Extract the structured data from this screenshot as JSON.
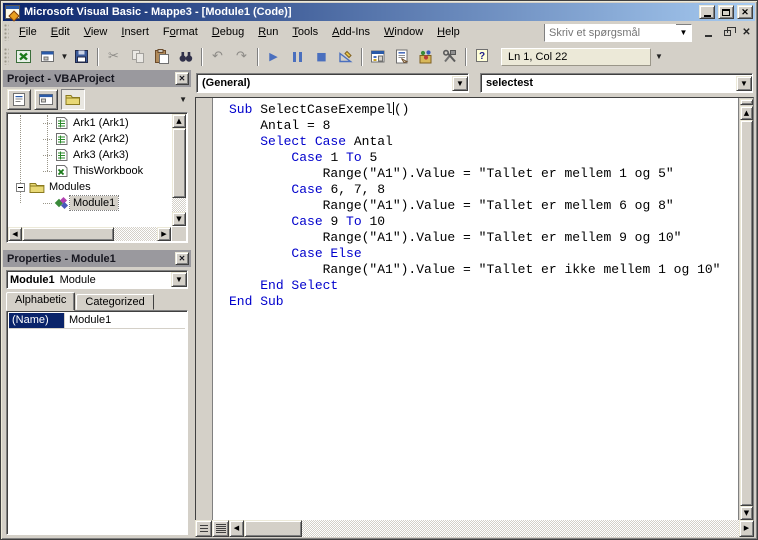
{
  "window": {
    "title": "Microsoft Visual Basic - Mappe3 - [Module1 (Code)]"
  },
  "menu_bar": {
    "items": [
      {
        "label": "File",
        "accel": 0
      },
      {
        "label": "Edit",
        "accel": 0
      },
      {
        "label": "View",
        "accel": 0
      },
      {
        "label": "Insert",
        "accel": 0
      },
      {
        "label": "Format",
        "accel": 1
      },
      {
        "label": "Debug",
        "accel": 0
      },
      {
        "label": "Run",
        "accel": 0
      },
      {
        "label": "Tools",
        "accel": 0
      },
      {
        "label": "Add-Ins",
        "accel": 0
      },
      {
        "label": "Window",
        "accel": 0
      },
      {
        "label": "Help",
        "accel": 0
      }
    ],
    "question_box": {
      "placeholder": "Skriv et spørgsmål"
    }
  },
  "toolbar": {
    "buttons": [
      {
        "name": "view-microsoft-excel",
        "icon": "excel"
      },
      {
        "name": "insert-userform",
        "icon": "userform",
        "dropdown": true
      },
      {
        "name": "save",
        "icon": "save"
      },
      {
        "sep": true
      },
      {
        "name": "cut",
        "icon": "cut",
        "disabled": true
      },
      {
        "name": "copy",
        "icon": "copy",
        "disabled": true
      },
      {
        "name": "paste",
        "icon": "paste"
      },
      {
        "name": "find",
        "icon": "find"
      },
      {
        "sep": true
      },
      {
        "name": "undo",
        "icon": "undo",
        "disabled": true
      },
      {
        "name": "redo",
        "icon": "redo",
        "disabled": true
      },
      {
        "sep": true
      },
      {
        "name": "run-sub",
        "icon": "run"
      },
      {
        "name": "break",
        "icon": "break"
      },
      {
        "name": "reset",
        "icon": "reset"
      },
      {
        "name": "design-mode",
        "icon": "design"
      },
      {
        "sep": true
      },
      {
        "name": "project-explorer",
        "icon": "project"
      },
      {
        "name": "properties-window",
        "icon": "props"
      },
      {
        "name": "object-browser",
        "icon": "objbrowser"
      },
      {
        "name": "toolbox",
        "icon": "toolbox"
      },
      {
        "sep": true
      },
      {
        "name": "help",
        "icon": "help"
      }
    ],
    "position_indicator": "Ln 1, Col 22"
  },
  "project_panel": {
    "title": "Project - VBAProject",
    "toolbar": [
      {
        "name": "view-code",
        "icon": "viewcode"
      },
      {
        "name": "view-object",
        "icon": "viewobject"
      },
      {
        "name": "toggle-folders",
        "icon": "folders",
        "pressed": true
      }
    ],
    "tree_items": [
      {
        "label": "Ark1 (Ark1)",
        "icon": "worksheet",
        "depth": 2
      },
      {
        "label": "Ark2 (Ark2)",
        "icon": "worksheet",
        "depth": 2
      },
      {
        "label": "Ark3 (Ark3)",
        "icon": "worksheet",
        "depth": 2
      },
      {
        "label": "ThisWorkbook",
        "icon": "workbook",
        "depth": 2
      },
      {
        "label": "Modules",
        "icon": "folder",
        "depth": 1,
        "expander": "minus"
      },
      {
        "label": "Module1",
        "icon": "module",
        "depth": 2,
        "selected": true
      }
    ]
  },
  "properties_panel": {
    "title": "Properties - Module1",
    "selected_object": "Module1",
    "selected_object_type": "Module",
    "tabs": [
      {
        "label": "Alphabetic",
        "active": true
      },
      {
        "label": "Categorized",
        "active": false
      }
    ],
    "rows": [
      {
        "property": "(Name)",
        "value": "Module1",
        "selected": true
      }
    ]
  },
  "code_window": {
    "object_box": "(General)",
    "procedure_box": "selectest",
    "lines": [
      [
        {
          "t": "Sub",
          "kw": true
        },
        {
          "t": " SelectCaseExempel"
        },
        {
          "caret": true
        },
        {
          "t": "()"
        }
      ],
      [
        {
          "t": "    Antal = 8"
        }
      ],
      [
        {
          "t": "    "
        },
        {
          "t": "Select Case",
          "kw": true
        },
        {
          "t": " Antal"
        }
      ],
      [
        {
          "t": "        "
        },
        {
          "t": "Case",
          "kw": true
        },
        {
          "t": " 1 "
        },
        {
          "t": "To",
          "kw": true
        },
        {
          "t": " 5"
        }
      ],
      [
        {
          "t": "            Range(\"A1\").Value = \"Tallet er mellem 1 og 5\""
        }
      ],
      [
        {
          "t": "        "
        },
        {
          "t": "Case",
          "kw": true
        },
        {
          "t": " 6, 7, 8"
        }
      ],
      [
        {
          "t": "            Range(\"A1\").Value = \"Tallet er mellem 6 og 8\""
        }
      ],
      [
        {
          "t": "        "
        },
        {
          "t": "Case",
          "kw": true
        },
        {
          "t": " 9 "
        },
        {
          "t": "To",
          "kw": true
        },
        {
          "t": " 10"
        }
      ],
      [
        {
          "t": "            Range(\"A1\").Value = \"Tallet er mellem 9 og 10\""
        }
      ],
      [
        {
          "t": "        "
        },
        {
          "t": "Case Else",
          "kw": true
        }
      ],
      [
        {
          "t": "            Range(\"A1\").Value = \"Tallet er ikke mellem 1 og 10\""
        }
      ],
      [
        {
          "t": "    "
        },
        {
          "t": "End Select",
          "kw": true
        }
      ],
      [
        {
          "t": "End Sub",
          "kw": true
        }
      ]
    ]
  },
  "colors": {
    "title_gradient_start": "#0a246a",
    "title_gradient_end": "#a6caf0",
    "chrome": "#d4d0c8",
    "keyword_blue": "#0000cc",
    "selection_navy": "#0a246a",
    "panel_header_bg": "#9a999e"
  }
}
